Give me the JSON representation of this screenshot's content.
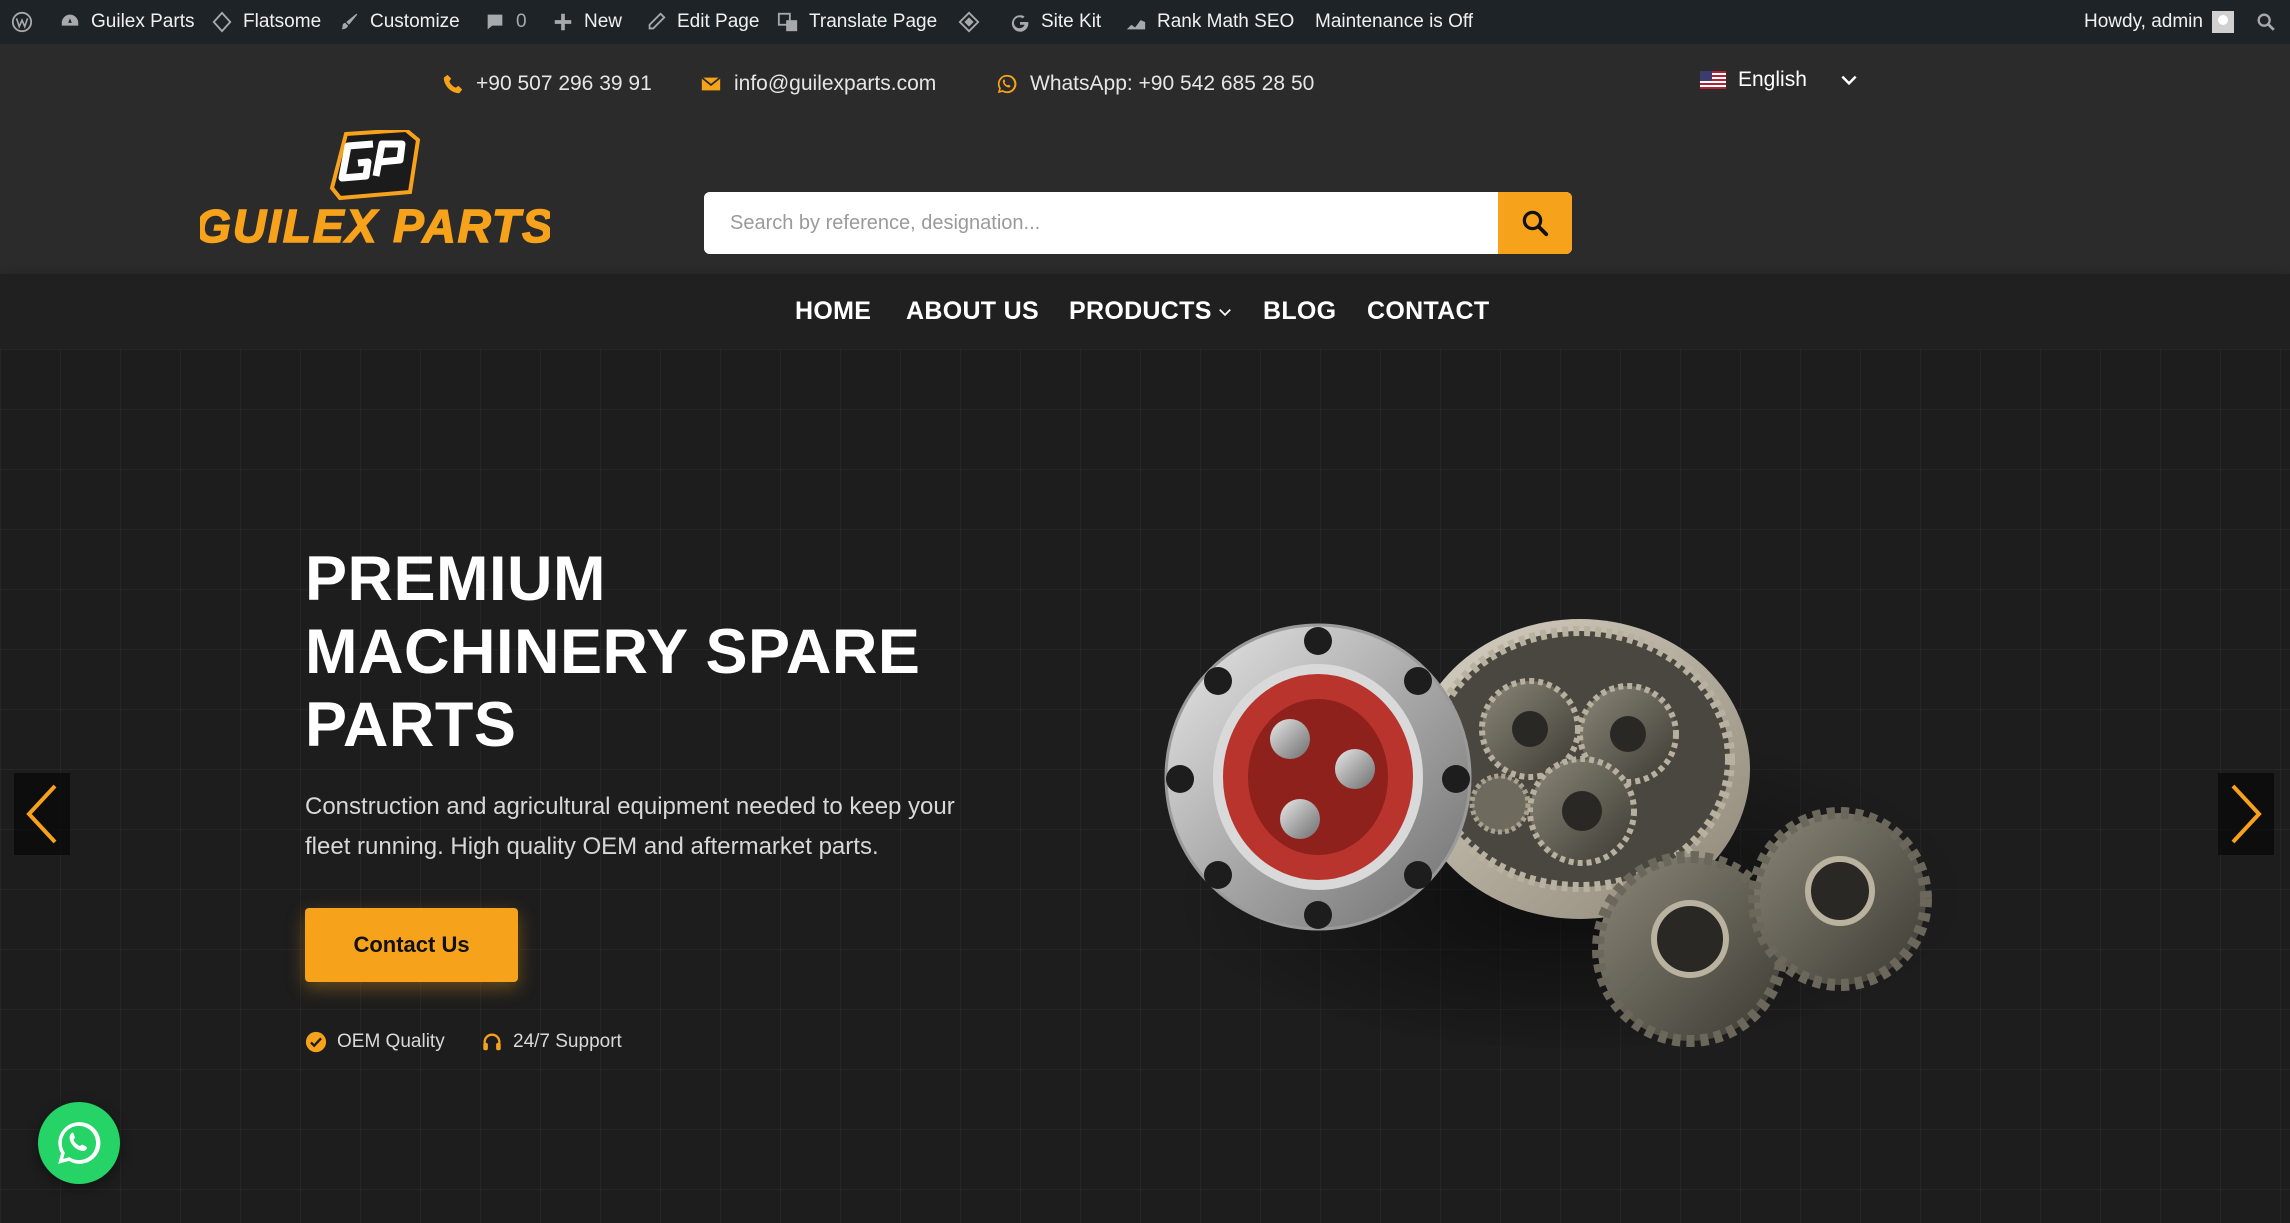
{
  "adminbar": {
    "site_name": "Guilex Parts",
    "theme": "Flatsome",
    "customize": "Customize",
    "comments_count": "0",
    "new": "New",
    "edit_page": "Edit Page",
    "translate_page": "Translate Page",
    "site_kit": "Site Kit",
    "rank_math": "Rank Math SEO",
    "maintenance": "Maintenance is Off",
    "howdy": "Howdy, admin"
  },
  "topbar": {
    "phone": "+90 507 296 39 91",
    "email": "info@guilexparts.com",
    "whatsapp": "WhatsApp: +90 542 685 28 50",
    "language": "English"
  },
  "logo": {
    "monogram": "GP",
    "wordmark": "GUILEX PARTS"
  },
  "search": {
    "placeholder": "Search by reference, designation..."
  },
  "nav": {
    "items": [
      {
        "label": "HOME"
      },
      {
        "label": "ABOUT US"
      },
      {
        "label": "PRODUCTS"
      },
      {
        "label": "BLOG"
      },
      {
        "label": "CONTACT"
      }
    ]
  },
  "hero": {
    "title_lines": [
      "PREMIUM",
      "MACHINERY SPARE",
      "PARTS"
    ],
    "subtitle": "Construction and agricultural equipment needed to keep your fleet running. High quality OEM and aftermarket parts.",
    "cta": "Contact Us",
    "badges": [
      "OEM Quality",
      "24/7 Support"
    ]
  },
  "colors": {
    "accent": "#f7a21b",
    "adminbar": "#1d2327",
    "header": "#2b2b2b",
    "whatsapp": "#25d366"
  }
}
